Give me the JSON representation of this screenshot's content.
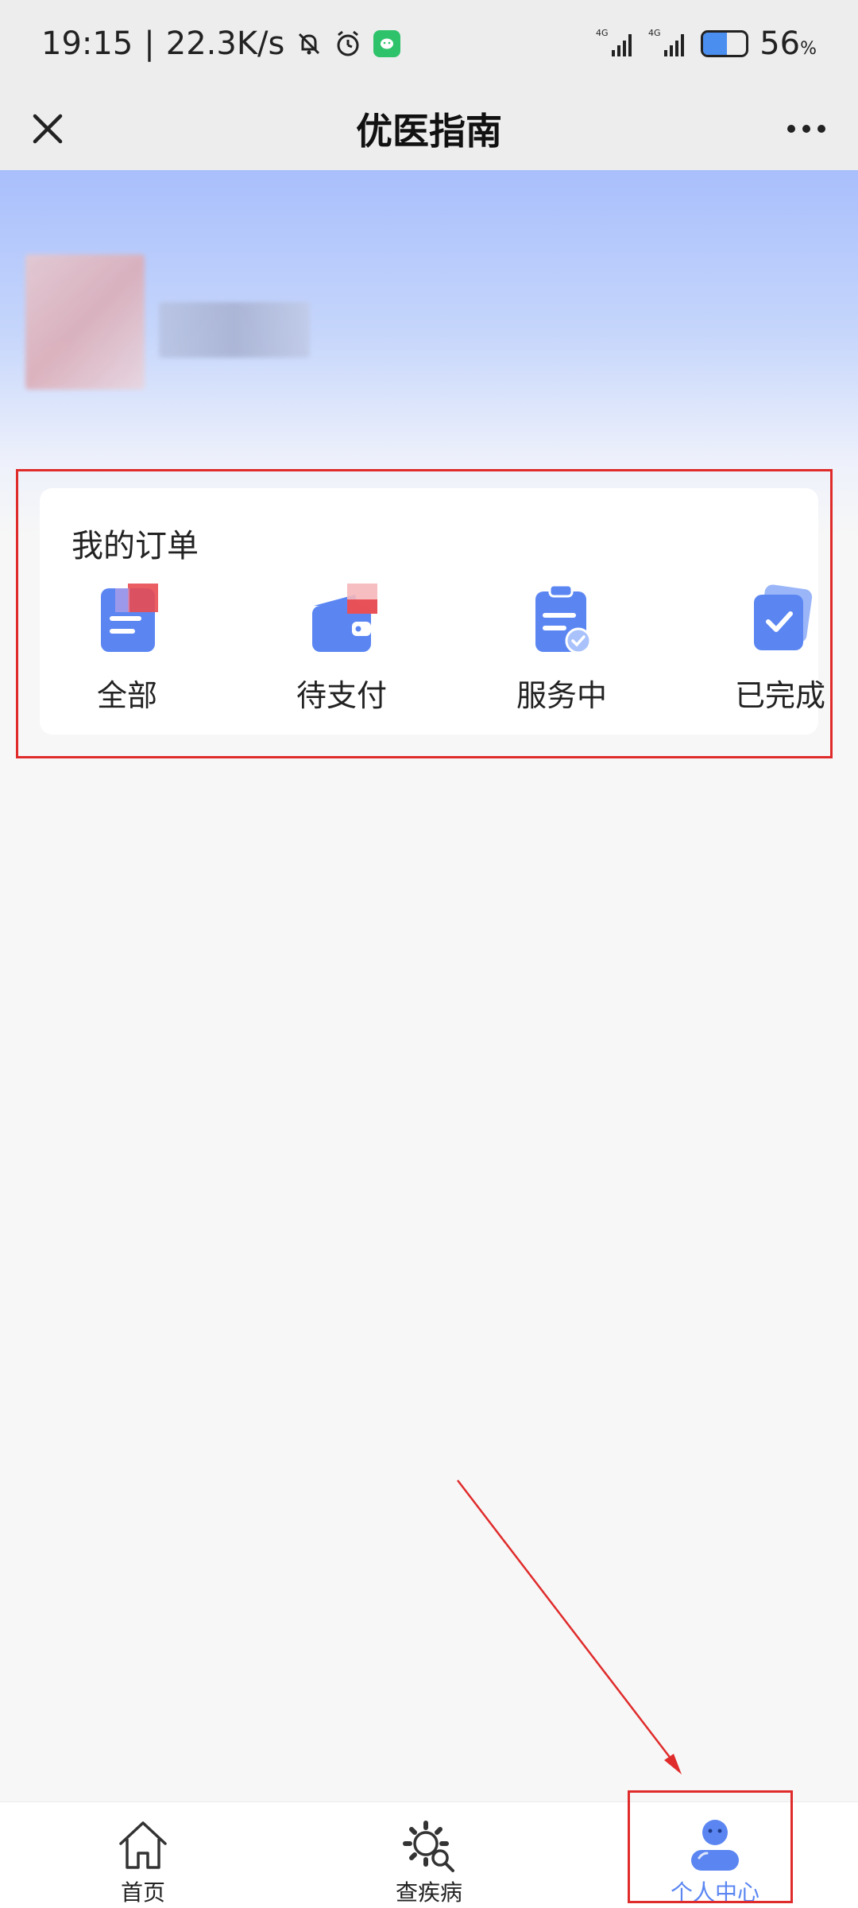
{
  "status_bar": {
    "time": "19:15",
    "speed": "22.3K/s",
    "network1": "4G",
    "network2": "4G",
    "battery": "56",
    "battery_unit": "%",
    "battery_level": 0.56
  },
  "title_bar": {
    "title": "优医指南"
  },
  "orders": {
    "title": "我的订单",
    "items": [
      {
        "label": "全部",
        "icon": "document-icon"
      },
      {
        "label": "待支付",
        "icon": "wallet-icon"
      },
      {
        "label": "服务中",
        "icon": "clipboard-check-icon"
      },
      {
        "label": "已完成",
        "icon": "completed-check-icon"
      }
    ]
  },
  "tab_bar": {
    "items": [
      {
        "label": "首页",
        "icon": "home-icon",
        "active": false
      },
      {
        "label": "查疾病",
        "icon": "gear-search-icon",
        "active": false
      },
      {
        "label": "个人中心",
        "icon": "user-icon",
        "active": true
      }
    ]
  },
  "colors": {
    "accent": "#5b86f2",
    "annotation": "#e02b2b",
    "hero_top": "#a9bffc"
  }
}
